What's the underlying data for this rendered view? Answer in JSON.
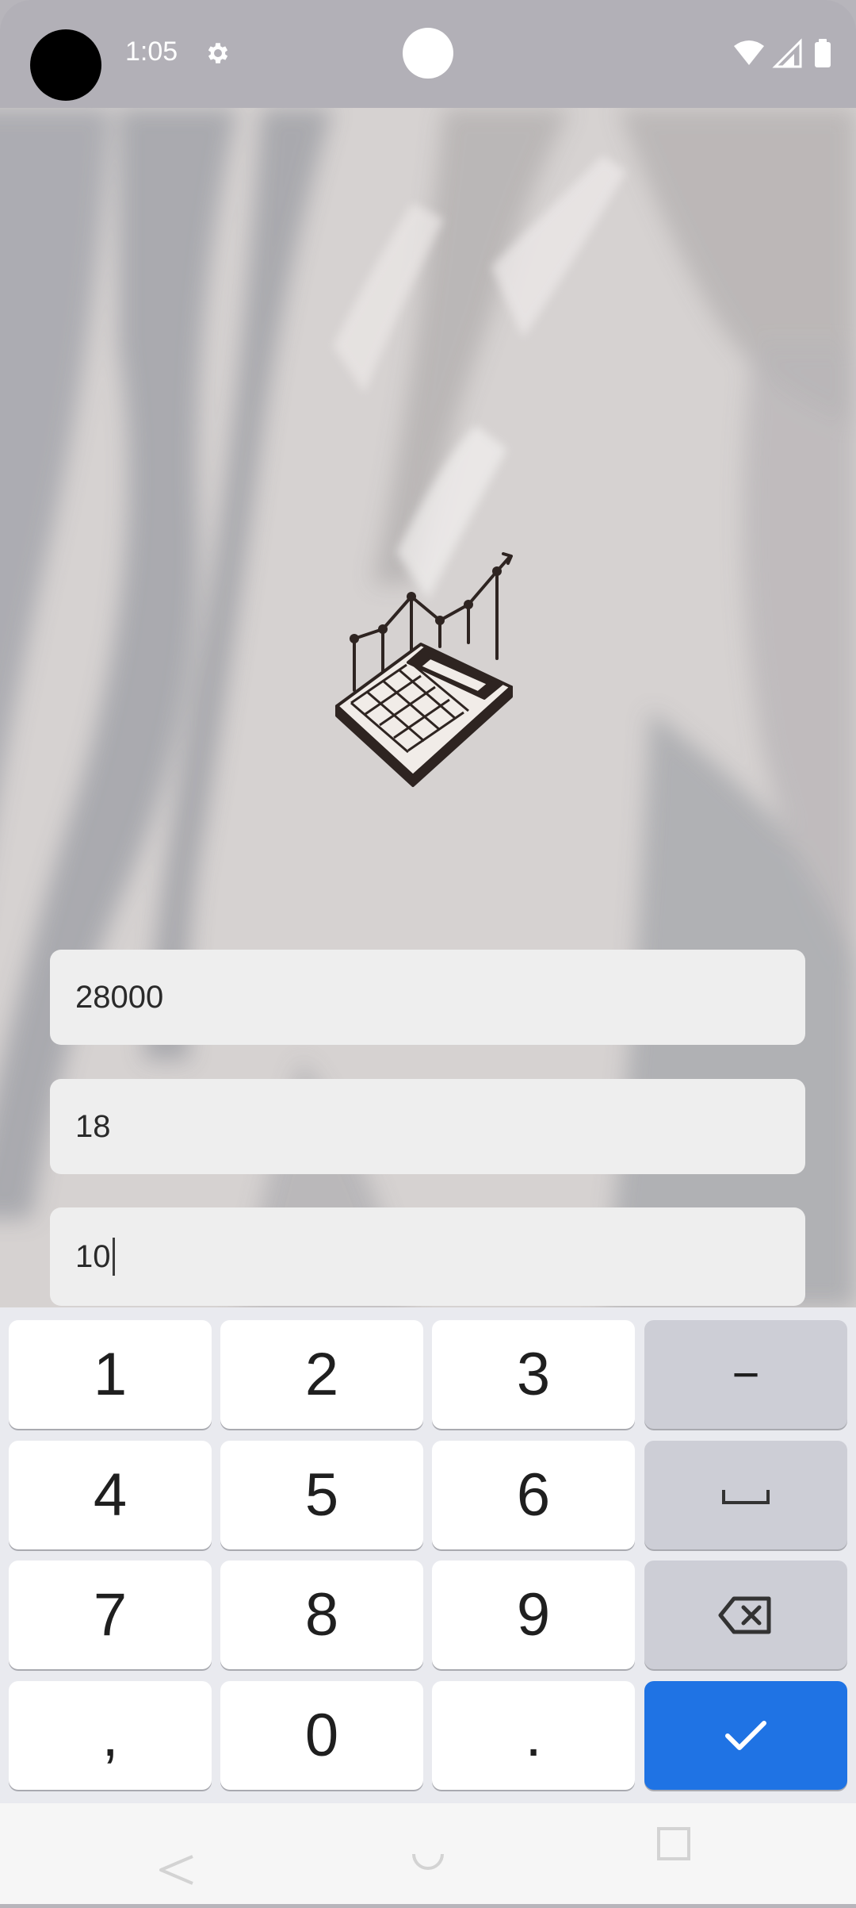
{
  "status_bar": {
    "time": "1:05"
  },
  "form": {
    "field_1_value": "28000",
    "field_2_value": "18",
    "field_3_value": "10"
  },
  "keyboard": {
    "keys": [
      "1",
      "2",
      "3",
      "−",
      "4",
      "5",
      "6",
      "7",
      "8",
      "9",
      ",",
      "0",
      "."
    ],
    "colors": {
      "key_bg": "#ffffff",
      "function_key_bg": "#cdced6",
      "done_key_bg": "#1f73e4"
    }
  },
  "icons": {
    "logo": "calculator-chart-logo",
    "space": "space-icon",
    "backspace": "backspace-icon",
    "done": "check-icon"
  }
}
